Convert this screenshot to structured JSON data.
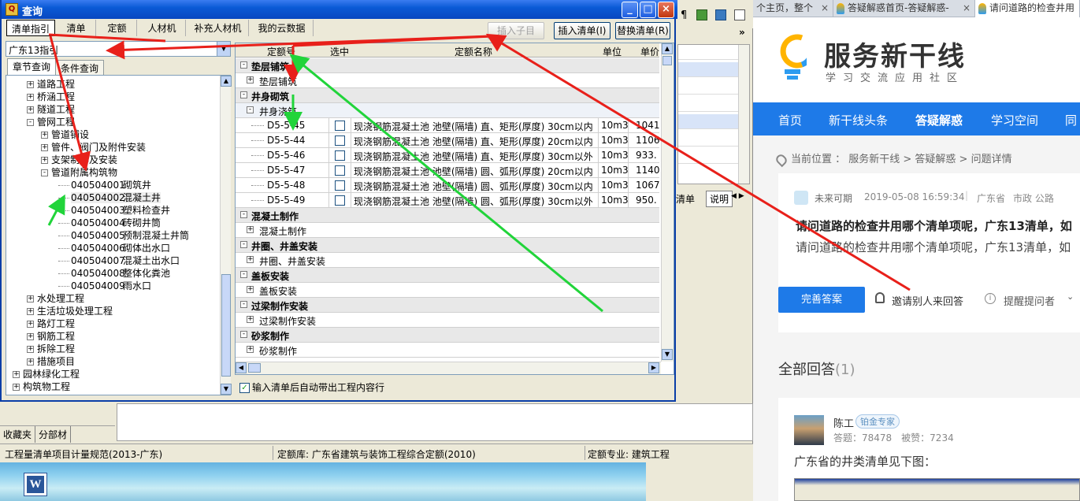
{
  "dialog": {
    "title": "查询",
    "top_tabs": [
      "清单指引",
      "清单",
      "定额",
      "人材机",
      "补充人材机",
      "我的云数据"
    ],
    "btn_insert_child": "插入子目",
    "btn_insert_list": "插入清单(I)",
    "btn_replace_list": "替换清单(R)",
    "combo_value": "广东13指引",
    "left_tabs": [
      "章节查询",
      "条件查询"
    ],
    "tree": [
      {
        "label": "道路工程",
        "level": 2,
        "pm": "+"
      },
      {
        "label": "桥涵工程",
        "level": 2,
        "pm": "+"
      },
      {
        "label": "隧道工程",
        "level": 2,
        "pm": "+"
      },
      {
        "label": "管网工程",
        "level": 2,
        "pm": "-"
      },
      {
        "label": "管道铺设",
        "level": 3,
        "pm": "+"
      },
      {
        "label": "管件、阀门及附件安装",
        "level": 3,
        "pm": "+"
      },
      {
        "label": "支架制作及安装",
        "level": 3,
        "pm": "+"
      },
      {
        "label": "管道附属构筑物",
        "level": 3,
        "pm": "-"
      },
      {
        "code": "040504001",
        "label": "砌筑井",
        "level": 4
      },
      {
        "code": "040504002",
        "label": "混凝土井",
        "level": 4,
        "selected": true
      },
      {
        "code": "040504003",
        "label": "塑料检查井",
        "level": 4
      },
      {
        "code": "040504004",
        "label": "砖砌井筒",
        "level": 4
      },
      {
        "code": "040504005",
        "label": "预制混凝土井筒",
        "level": 4
      },
      {
        "code": "040504006",
        "label": "砌体出水口",
        "level": 4
      },
      {
        "code": "040504007",
        "label": "混凝土出水口",
        "level": 4
      },
      {
        "code": "040504008",
        "label": "整体化粪池",
        "level": 4
      },
      {
        "code": "040504009",
        "label": "雨水口",
        "level": 4
      },
      {
        "label": "水处理工程",
        "level": 2,
        "pm": "+"
      },
      {
        "label": "生活垃圾处理工程",
        "level": 2,
        "pm": "+"
      },
      {
        "label": "路灯工程",
        "level": 2,
        "pm": "+"
      },
      {
        "label": "钢筋工程",
        "level": 2,
        "pm": "+"
      },
      {
        "label": "拆除工程",
        "level": 2,
        "pm": "+"
      },
      {
        "label": "措施项目",
        "level": 2,
        "pm": "+"
      },
      {
        "label": "园林绿化工程",
        "level": 1,
        "pm": "+"
      },
      {
        "label": "构筑物工程",
        "level": 1,
        "pm": "+"
      }
    ],
    "grid_headers": {
      "code": "定额号",
      "select": "选中",
      "name": "定额名称",
      "unit": "单位",
      "price": "单价"
    },
    "grid_rows": [
      {
        "type": "grp",
        "label": "垫层铺筑"
      },
      {
        "type": "sub",
        "label": "垫层铺筑"
      },
      {
        "type": "grp",
        "label": "井身砌筑"
      },
      {
        "type": "sub2",
        "label": "井身浇筑"
      },
      {
        "type": "item",
        "code": "D5-5-45",
        "name": "现浇钢筋混凝土池 池壁(隔墙) 直、矩形(厚度) 30cm以内",
        "unit": "10m3",
        "price": "1041."
      },
      {
        "type": "item",
        "code": "D5-5-44",
        "name": "现浇钢筋混凝土池 池壁(隔墙) 直、矩形(厚度) 20cm以内",
        "unit": "10m3",
        "price": "1106."
      },
      {
        "type": "item",
        "code": "D5-5-46",
        "name": "现浇钢筋混凝土池 池壁(隔墙) 直、矩形(厚度) 30cm以外",
        "unit": "10m3",
        "price": "933."
      },
      {
        "type": "item",
        "code": "D5-5-47",
        "name": "现浇钢筋混凝土池 池壁(隔墙) 圆、弧形(厚度) 20cm以内",
        "unit": "10m3",
        "price": "1140."
      },
      {
        "type": "item",
        "code": "D5-5-48",
        "name": "现浇钢筋混凝土池 池壁(隔墙) 圆、弧形(厚度) 30cm以内",
        "unit": "10m3",
        "price": "1067."
      },
      {
        "type": "item",
        "code": "D5-5-49",
        "name": "现浇钢筋混凝土池 池壁(隔墙) 圆、弧形(厚度) 30cm以外",
        "unit": "10m3",
        "price": "950."
      },
      {
        "type": "grp",
        "label": "混凝土制作"
      },
      {
        "type": "sub",
        "label": "混凝土制作"
      },
      {
        "type": "grp",
        "label": "井圈、井盖安装"
      },
      {
        "type": "sub",
        "label": "井圈、井盖安装"
      },
      {
        "type": "grp",
        "label": "盖板安装"
      },
      {
        "type": "sub",
        "label": "盖板安装"
      },
      {
        "type": "grp",
        "label": "过梁制作安装"
      },
      {
        "type": "sub",
        "label": "过梁制作安装"
      },
      {
        "type": "grp",
        "label": "砂浆制作"
      },
      {
        "type": "sub",
        "label": "砂浆制作"
      }
    ],
    "auto_check_label": "输入清单后自动带出工程内容行"
  },
  "background_app": {
    "fav_tabs": [
      "收藏夹",
      "分部材"
    ],
    "bg_tabs": [
      "清单",
      "说明"
    ],
    "status": {
      "spec": "工程量清单项目计量规范(2013-广东)",
      "quota_lib": "定额库:  广东省建筑与装饰工程综合定额(2010)",
      "quota_major": "定额专业:  建筑工程"
    }
  },
  "desktop": {
    "word_icon": "W"
  },
  "browser": {
    "tabs": [
      {
        "label": "个主页，整个",
        "close": "×"
      },
      {
        "label": "答疑解惑首页-答疑解惑-",
        "close": "×"
      },
      {
        "label": "请问道路的检查井用",
        "close": ""
      }
    ],
    "logo_text": "服务新干线",
    "logo_sub": "学习交流应用社区",
    "nav": [
      "首页",
      "新干线头条",
      "答疑解惑",
      "学习空间",
      "同"
    ],
    "breadcrumb": "当前位置 ： 服务新干线 > 答疑解惑 > 问题详情",
    "question": {
      "user": "未来可期",
      "time": "2019-05-08 16:59:34",
      "region": "广东省",
      "category": "市政 公路",
      "title": "请问道路的检查井用哪个清单项呢，广东13清单，如",
      "body": "请问道路的检查井用哪个清单项呢，广东13清单，如",
      "btn_answer": "完善答案",
      "btn_invite": "邀请别人来回答",
      "btn_remind": "提醒提问者"
    },
    "answers_title": "全部回答",
    "answers_count": "(1)",
    "answer": {
      "user": "陈工",
      "badge": "铂金专家",
      "stats": "答题：78478　被赞：7234",
      "text": "广东省的井类清单见下图："
    }
  },
  "colors": {
    "arrow_red": "#e8201a",
    "arrow_green": "#21d43a",
    "brand_blue": "#1e7ae8",
    "xp_title": "#0a5ad6"
  }
}
